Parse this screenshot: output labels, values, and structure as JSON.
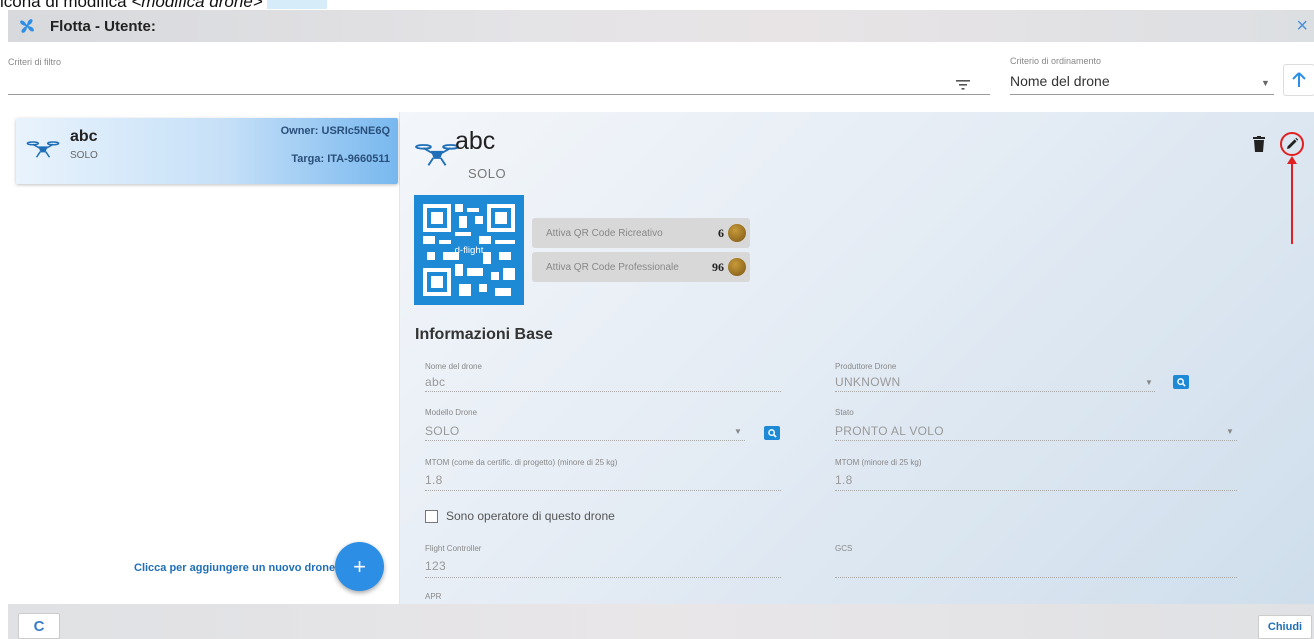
{
  "caption": {
    "prefix": "icona di modifica ",
    "italic": "<modifica drone>"
  },
  "window": {
    "title": "Flotta - Utente:",
    "close_label": "×"
  },
  "filter": {
    "label": "Criteri di filtro",
    "value": ""
  },
  "sort": {
    "label": "Criterio di ordinamento",
    "value": "Nome del drone",
    "caret": "▼",
    "direction_icon": "arrow-up-icon"
  },
  "drone_list": [
    {
      "name": "abc",
      "type": "SOLO",
      "owner": "Owner: USRIc5NE6Q",
      "plate": "Targa: ITA-9660511"
    }
  ],
  "add_drone": {
    "text": "Clicca per aggiungere un nuovo drone.",
    "icon": "+"
  },
  "detail": {
    "name": "abc",
    "type": "SOLO",
    "qr_buttons": [
      {
        "label": "Attiva QR Code Ricreativo",
        "cost": "6"
      },
      {
        "label": "Attiva QR Code Professionale",
        "cost": "96"
      }
    ],
    "qr_watermark": "d-flight",
    "section_title": "Informazioni Base",
    "fields": {
      "drone_name": {
        "label": "Nome del drone",
        "value": "abc"
      },
      "producer": {
        "label": "Produttore Drone",
        "value": "UNKNOWN"
      },
      "model": {
        "label": "Modello Drone",
        "value": "SOLO"
      },
      "status": {
        "label": "Stato",
        "value": "PRONTO AL VOLO"
      },
      "mtom_cert": {
        "label": "MTOM (come da certific. di progetto) (minore di 25 kg)",
        "value": "1.8"
      },
      "mtom": {
        "label": "MTOM (minore di 25 kg)",
        "value": "1.8"
      },
      "flight_controller": {
        "label": "Flight Controller",
        "value": "123"
      },
      "gcs": {
        "label": "GCS",
        "value": ""
      },
      "apr": {
        "label": "APR",
        "value": ""
      }
    },
    "operator_checkbox": {
      "label": "Sono operatore di questo drone",
      "checked": false
    }
  },
  "footer": {
    "refresh_icon": "C",
    "close_label": "Chiudi"
  },
  "colors": {
    "accent": "#2d8ee6",
    "highlight_ring": "#e02020",
    "qr_bg": "#1e8ad6"
  }
}
